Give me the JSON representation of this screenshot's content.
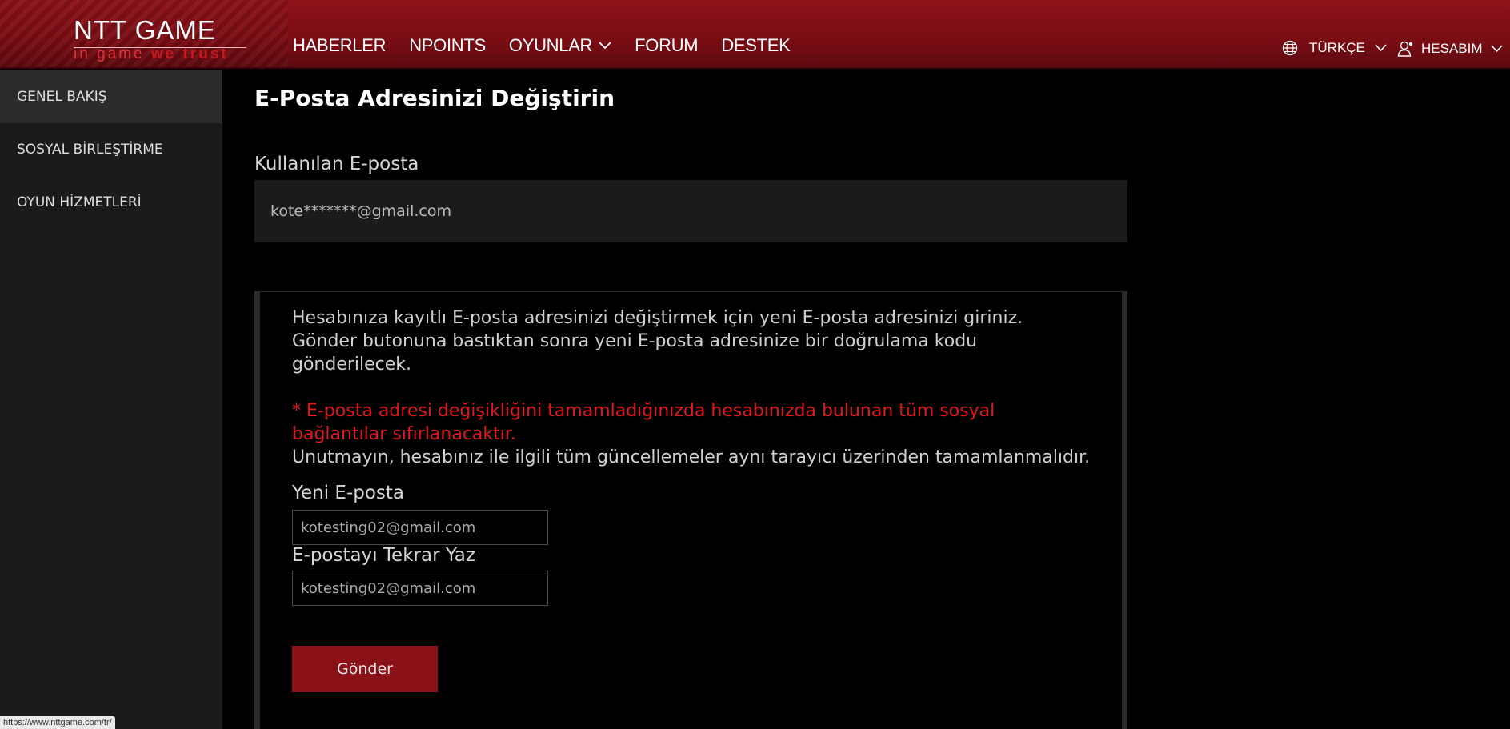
{
  "header": {
    "logo_title": "NTT GAME",
    "logo_tagline_a": "in game",
    "logo_tagline_b": "we trust",
    "nav": [
      {
        "label": "HABERLER"
      },
      {
        "label": "NPOINTS"
      },
      {
        "label": "OYUNLAR"
      },
      {
        "label": "FORUM"
      },
      {
        "label": "DESTEK"
      }
    ],
    "language": "TÜRKÇE",
    "account": "HESABIM"
  },
  "sidebar": {
    "items": [
      {
        "label": "GENEL BAKIŞ"
      },
      {
        "label": "SOSYAL BİRLEŞTİRME"
      },
      {
        "label": "OYUN HİZMETLERİ"
      }
    ]
  },
  "main": {
    "title": "E-Posta Adresinizi Değiştirin",
    "current_label": "Kullanılan E-posta",
    "current_value": "kote*******@gmail.com",
    "instructions": "Hesabınıza kayıtlı E-posta adresinizi değiştirmek için yeni E-posta adresinizi giriniz. Gönder butonuna bastıktan sonra yeni E-posta adresinize bir doğrulama kodu gönderilecek.",
    "warning": "* E-posta adresi değişikliğini tamamladığınızda hesabınızda bulunan tüm sosyal bağlantılar sıfırlanacaktır.",
    "note": "Unutmayın, hesabınız ile ilgili tüm güncellemeler aynı tarayıcı üzerinden tamamlanmalıdır.",
    "new_email_label": "Yeni E-posta",
    "new_email_value": "kotesting02@gmail.com",
    "repeat_email_label": "E-postayı Tekrar Yaz",
    "repeat_email_value": "kotesting02@gmail.com",
    "send_label": "Gönder"
  },
  "status_bar_url": "https://www.nttgame.com/tr/",
  "colors": {
    "header_red": "#8d1219",
    "accent_red": "#e3161e",
    "button_red": "#8b1118",
    "sidebar_bg": "#1b1b1b"
  }
}
